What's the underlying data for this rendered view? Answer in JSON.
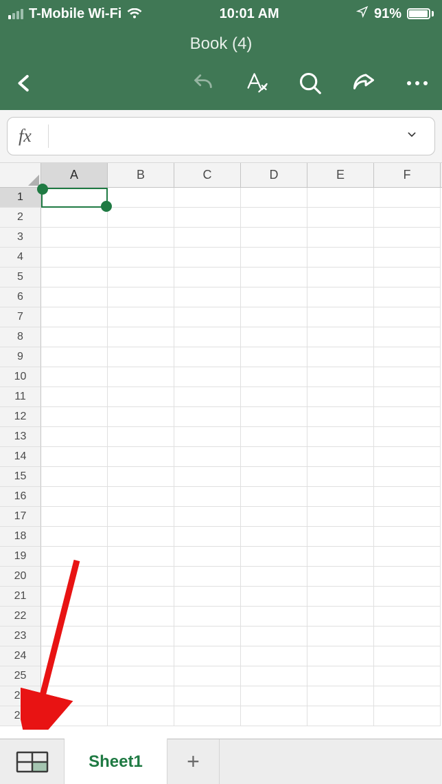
{
  "status": {
    "carrier": "T-Mobile Wi-Fi",
    "time": "10:01 AM",
    "battery_pct": "91%",
    "battery_fill_pct": 91
  },
  "header": {
    "title": "Book (4)"
  },
  "formula": {
    "fx": "fx",
    "value": ""
  },
  "grid": {
    "columns": [
      "A",
      "B",
      "C",
      "D",
      "E",
      "F"
    ],
    "rows": [
      "1",
      "2",
      "3",
      "4",
      "5",
      "6",
      "7",
      "8",
      "9",
      "10",
      "11",
      "12",
      "13",
      "14",
      "15",
      "16",
      "17",
      "18",
      "19",
      "20",
      "21",
      "22",
      "23",
      "24",
      "25",
      "26",
      "27"
    ],
    "selected_cell": "A1"
  },
  "sheets": {
    "active": "Sheet1",
    "add_label": "+"
  }
}
